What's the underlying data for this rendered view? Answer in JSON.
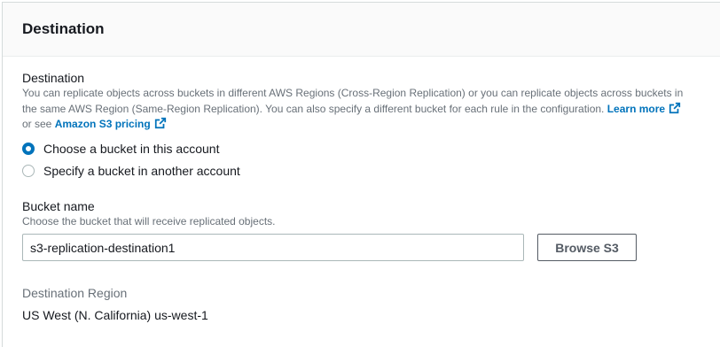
{
  "panel": {
    "title": "Destination"
  },
  "destination": {
    "label": "Destination",
    "description_line1": "You can replicate objects across buckets in different AWS Regions (Cross-Region Replication) or you can replicate objects across buckets in",
    "description_line2": "the same AWS Region (Same-Region Replication). You can also specify a different bucket for each rule in the configuration.",
    "learn_more": "Learn more",
    "or_see": "or see",
    "pricing_link": "Amazon S3 pricing",
    "options": [
      {
        "label": "Choose a bucket in this account",
        "selected": true
      },
      {
        "label": "Specify a bucket in another account",
        "selected": false
      }
    ]
  },
  "bucket": {
    "label": "Bucket name",
    "description": "Choose the bucket that will receive replicated objects.",
    "value": "s3-replication-destination1",
    "browse_label": "Browse S3"
  },
  "region": {
    "label": "Destination Region",
    "value": "US West (N. California) us-west-1"
  },
  "colors": {
    "link": "#0073bb",
    "radio_selected": "#0073bb",
    "muted_text": "#687078"
  },
  "icons": {
    "external": "external-link-icon"
  }
}
